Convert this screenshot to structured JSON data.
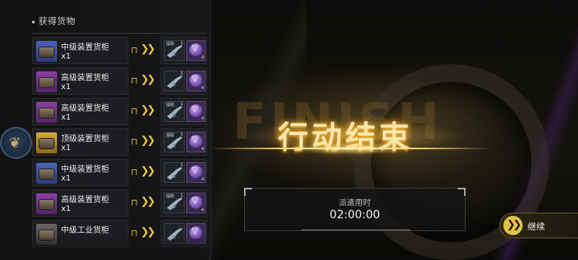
{
  "panel": {
    "title": "获得货物"
  },
  "items": [
    {
      "name": "中级装置货柜",
      "qty": "x1",
      "chest": "blue",
      "gun_tag": "提取",
      "gun_n": "1",
      "chip_n": "4"
    },
    {
      "name": "高级装置货柜",
      "qty": "x1",
      "chest": "purple",
      "gun_tag": "",
      "gun_n": "1",
      "chip_n": "4"
    },
    {
      "name": "高级装置货柜",
      "qty": "x1",
      "chest": "purple",
      "gun_tag": "提取",
      "gun_n": "1",
      "chip_n": "4"
    },
    {
      "name": "顶级装置货柜",
      "qty": "x1",
      "chest": "gold",
      "gun_tag": "提取",
      "gun_n": "1",
      "chip_n": "4"
    },
    {
      "name": "中级装置货柜",
      "qty": "x1",
      "chest": "blue",
      "gun_tag": "",
      "gun_n": "1",
      "chip_n": "4"
    },
    {
      "name": "高级装置货柜",
      "qty": "x1",
      "chest": "purple",
      "gun_tag": "提取",
      "gun_n": "1",
      "chip_n": "4"
    },
    {
      "name": "中级工业货柜",
      "qty": "",
      "chest": "gray",
      "gun_tag": "",
      "gun_n": "",
      "chip_n": ""
    }
  ],
  "result": {
    "bg_text": "FINISH",
    "title": "行动结束",
    "time_label": "派遣用时",
    "time_value": "02:00:00"
  },
  "continue_button": {
    "label": "继续",
    "icon": "double-chevron-right"
  },
  "colors": {
    "accent_gold": "#e3c14a",
    "chip_purple": "#7a4fb3"
  }
}
